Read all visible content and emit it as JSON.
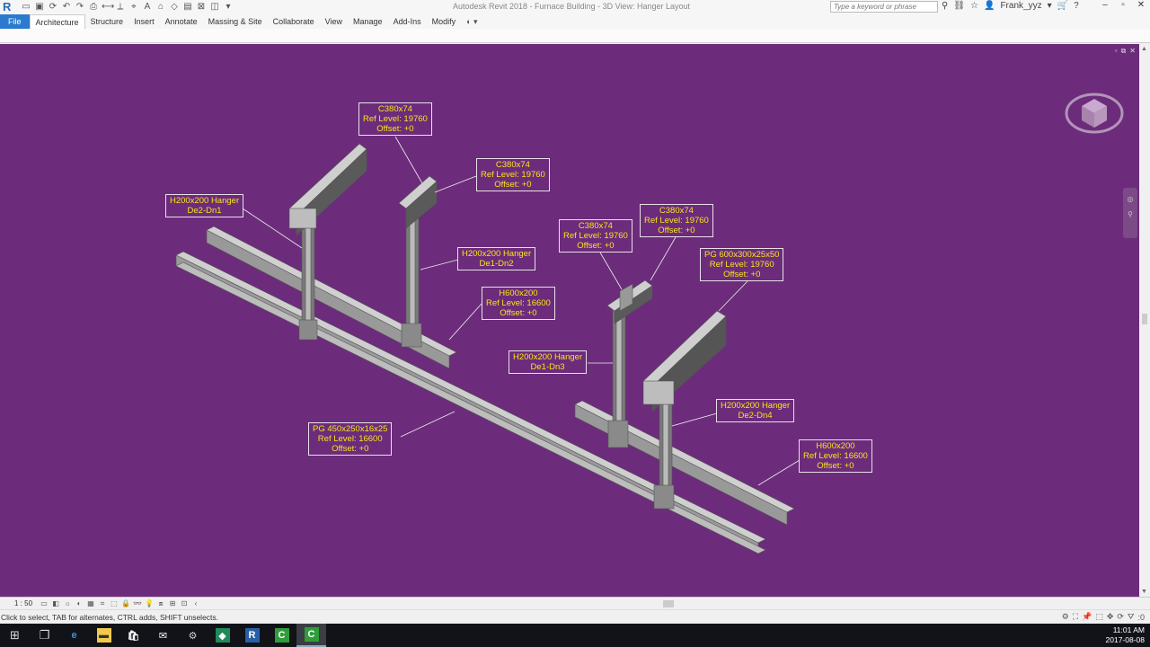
{
  "app": {
    "title": "Autodesk Revit 2018  -  Furnace Building - 3D View: Hanger Layout",
    "search_placeholder": "Type a keyword or phrase",
    "user": "Frank_yyz"
  },
  "ribbon": {
    "tabs": [
      "File",
      "Architecture",
      "Structure",
      "Insert",
      "Annotate",
      "Massing & Site",
      "Collaborate",
      "View",
      "Manage",
      "Add-Ins",
      "Modify"
    ],
    "active": "Architecture"
  },
  "tags": [
    {
      "id": "c380-1",
      "lines": [
        "C380x74",
        "Ref Level: 19760",
        "Offset:  +0"
      ]
    },
    {
      "id": "c380-2",
      "lines": [
        "C380x74",
        "Ref Level: 19760",
        "Offset:  +0"
      ]
    },
    {
      "id": "h200-dn1",
      "lines": [
        "H200x200 Hanger",
        "De2-Dn1"
      ]
    },
    {
      "id": "h200-dn2",
      "lines": [
        "H200x200 Hanger",
        "De1-Dn2"
      ]
    },
    {
      "id": "h600-1",
      "lines": [
        "H600x200",
        "Ref Level: 16600",
        "Offset:  +0"
      ]
    },
    {
      "id": "c380-3",
      "lines": [
        "C380x74",
        "Ref Level: 19760",
        "Offset:  +0"
      ]
    },
    {
      "id": "c380-4",
      "lines": [
        "C380x74",
        "Ref Level: 19760",
        "Offset:  +0"
      ]
    },
    {
      "id": "pg600",
      "lines": [
        "PG 600x300x25x50",
        "Ref Level: 19760",
        "Offset:  +0"
      ]
    },
    {
      "id": "h200-dn3",
      "lines": [
        "H200x200 Hanger",
        "De1-Dn3"
      ]
    },
    {
      "id": "h200-dn4",
      "lines": [
        "H200x200 Hanger",
        "De2-Dn4"
      ]
    },
    {
      "id": "pg450",
      "lines": [
        "PG 450x250x16x25",
        "Ref Level: 16600",
        "Offset:  +0"
      ]
    },
    {
      "id": "h600-2",
      "lines": [
        "H600x200",
        "Ref Level: 16600",
        "Offset:  +0"
      ]
    }
  ],
  "viewbar": {
    "scale": "1 : 50"
  },
  "status": {
    "message": "Click to select, TAB for alternates, CTRL adds, SHIFT unselects.",
    "filter_count": ":0"
  },
  "taskbar": {
    "time": "11:01 AM",
    "date": "2017-08-08"
  },
  "colors": {
    "viewport_bg": "#6c2c7b",
    "tag_text": "#f6e51c",
    "file_tab": "#2a7bcd"
  }
}
